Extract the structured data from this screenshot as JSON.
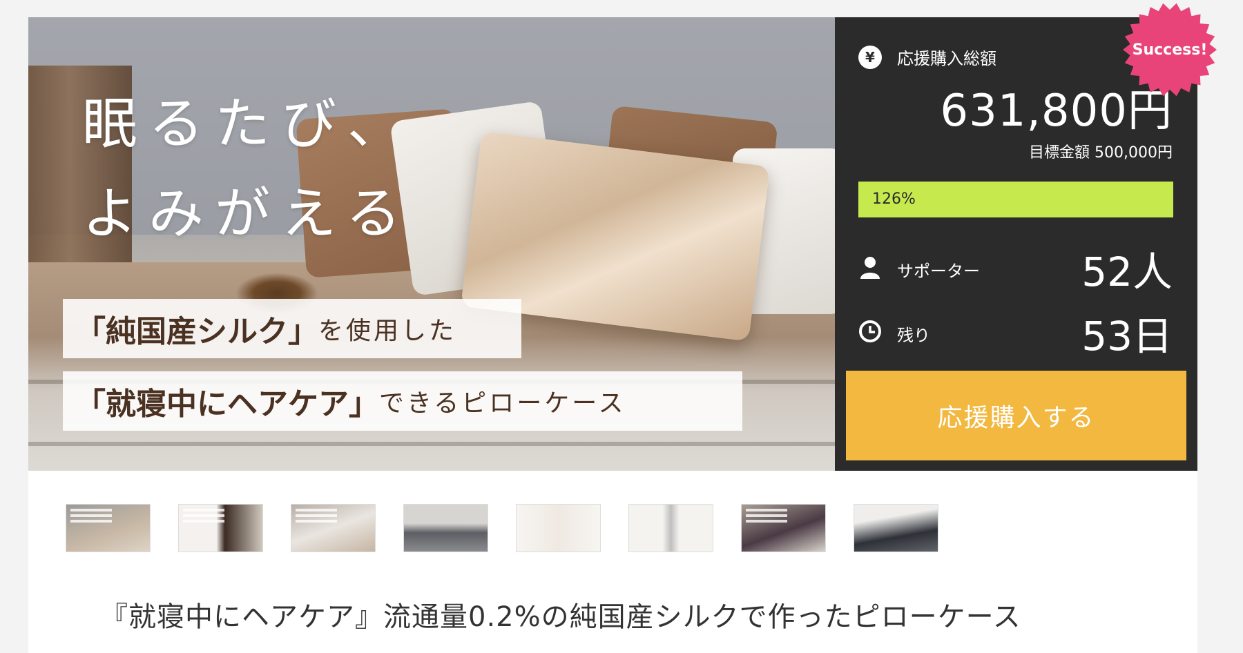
{
  "hero": {
    "headline_line1": "眠るたび、",
    "headline_line2": "よみがえる",
    "banner1_strong": "「純国産シルク」",
    "banner1_rest": "を使用した",
    "banner2_strong": "「就寝中にヘアケア」",
    "banner2_rest": "できるピローケース"
  },
  "stats": {
    "yen_icon": "¥",
    "total_label": "応援購入総額",
    "total_amount": "631,800円",
    "goal_text": "目標金額 500,000円",
    "progress_percent_label": "126%",
    "progress_ratio": 1.26,
    "supporters_label": "サポーター",
    "supporters_value": "52人",
    "remaining_label": "残り",
    "remaining_value": "53日",
    "buy_button": "応援購入する",
    "badge": "Success!",
    "progress_color": "#c6ea4e",
    "button_color": "#f2b83f",
    "badge_color": "#e9447a"
  },
  "thumbnails": [
    "thumb-1",
    "thumb-2",
    "thumb-3",
    "thumb-4",
    "thumb-5",
    "thumb-6",
    "thumb-7",
    "thumb-8"
  ],
  "project_title": "『就寝中にヘアケア』流通量0.2%の純国産シルクで作ったピローケース"
}
